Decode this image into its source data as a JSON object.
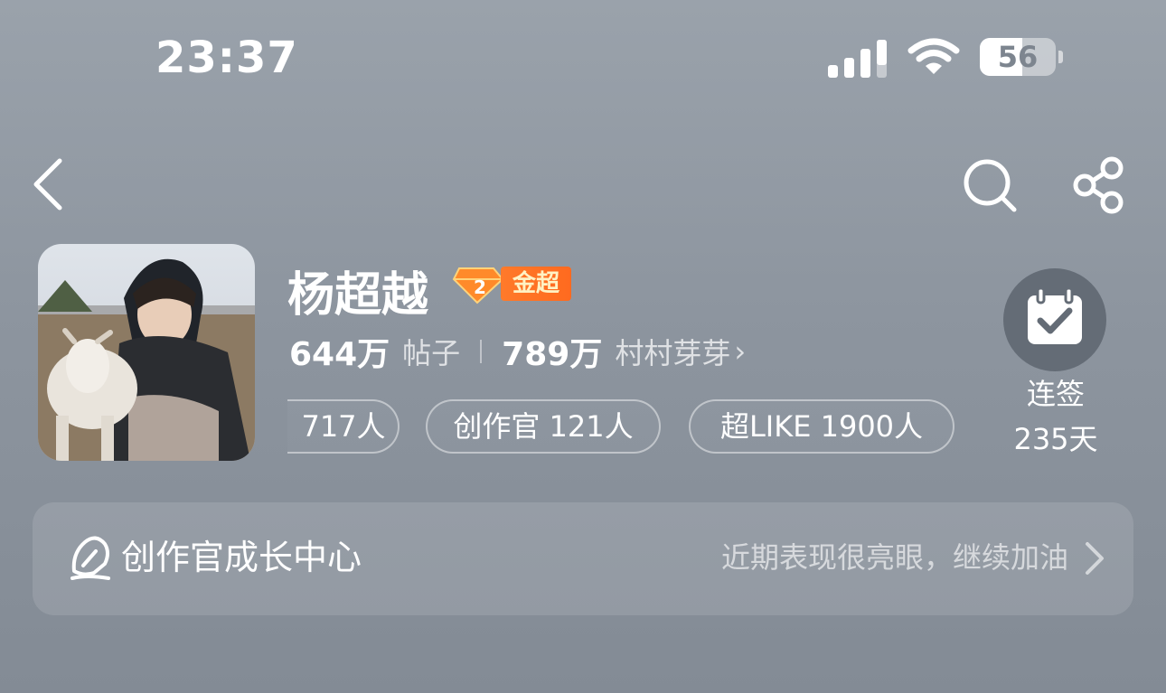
{
  "status_bar": {
    "time": "23:37",
    "battery": "56",
    "battery_level": 0.56
  },
  "header": {
    "back_icon": "chevron-left-icon",
    "search_icon": "search-icon",
    "share_icon": "share-icon"
  },
  "profile": {
    "name": "杨超越",
    "badge": {
      "level": "2",
      "label": "金超",
      "color": "#ff6a1f"
    },
    "stats": [
      {
        "value": "644万",
        "label": "帖子"
      },
      {
        "value": "789万",
        "label": "村村芽芽"
      }
    ],
    "chips": [
      {
        "label": "717人"
      },
      {
        "label": "创作官 121人"
      },
      {
        "label": "超LIKE 1900人"
      }
    ]
  },
  "checkin": {
    "label": "连签",
    "days": "235天",
    "icon": "calendar-check-icon"
  },
  "growth": {
    "title": "创作官成长中心",
    "hint": "近期表现很亮眼，继续加油",
    "icon": "creator-pen-icon"
  }
}
